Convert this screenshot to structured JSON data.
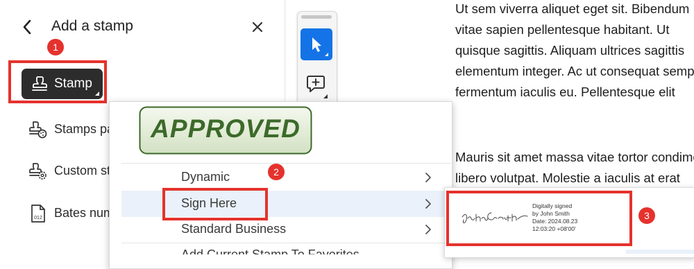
{
  "panel": {
    "title": "Add a stamp",
    "stamp_button_label": "Stamp",
    "menu_items": [
      {
        "label": "Stamps palette",
        "icon": "stamp-palette-icon"
      },
      {
        "label": "Custom stamps",
        "icon": "stamp-gear-icon"
      },
      {
        "label": "Bates numbering",
        "icon": "bates-file-icon"
      }
    ],
    "icons": {
      "back": "chevron-left-icon",
      "close": "close-icon",
      "stamp": "stamp-icon"
    }
  },
  "steps": [
    "1",
    "2",
    "3"
  ],
  "toolbar": {
    "tools": [
      "select-tool",
      "add-comment-tool"
    ]
  },
  "dropdown": {
    "approved_stamp_text": "APPROVED",
    "rows": [
      {
        "label": "Dynamic"
      },
      {
        "label": "Sign Here"
      },
      {
        "label": "Standard Business"
      },
      {
        "label": "Add Current Stamp To Favorites"
      }
    ]
  },
  "signature_preview": {
    "signature": "John Smith",
    "lines": [
      "Digitally signed",
      "by John Smith",
      "Date: 2024.08.23",
      "12:03:20 +08'00'"
    ]
  },
  "document": {
    "lines": [
      "Ut sem viverra aliquet eget sit. Bibendum",
      "vitae sapien pellentesque habitant. Ut",
      "quisque sagittis. Aliquam ultrices sagittis",
      "elementum integer. Ac ut consequat semper",
      "fermentum iaculis eu. Pellentesque elit",
      "",
      "Mauris sit amet massa vitae tortor condimentum",
      "libero volutpat. Molestie a iaculis at erat"
    ]
  },
  "colors": {
    "accent_red": "#e5322d",
    "select_blue": "#1473e6",
    "approved_green": "#3c6a2a",
    "approved_fill": "#e3ecd7",
    "dark_button": "#2c2c2c"
  }
}
